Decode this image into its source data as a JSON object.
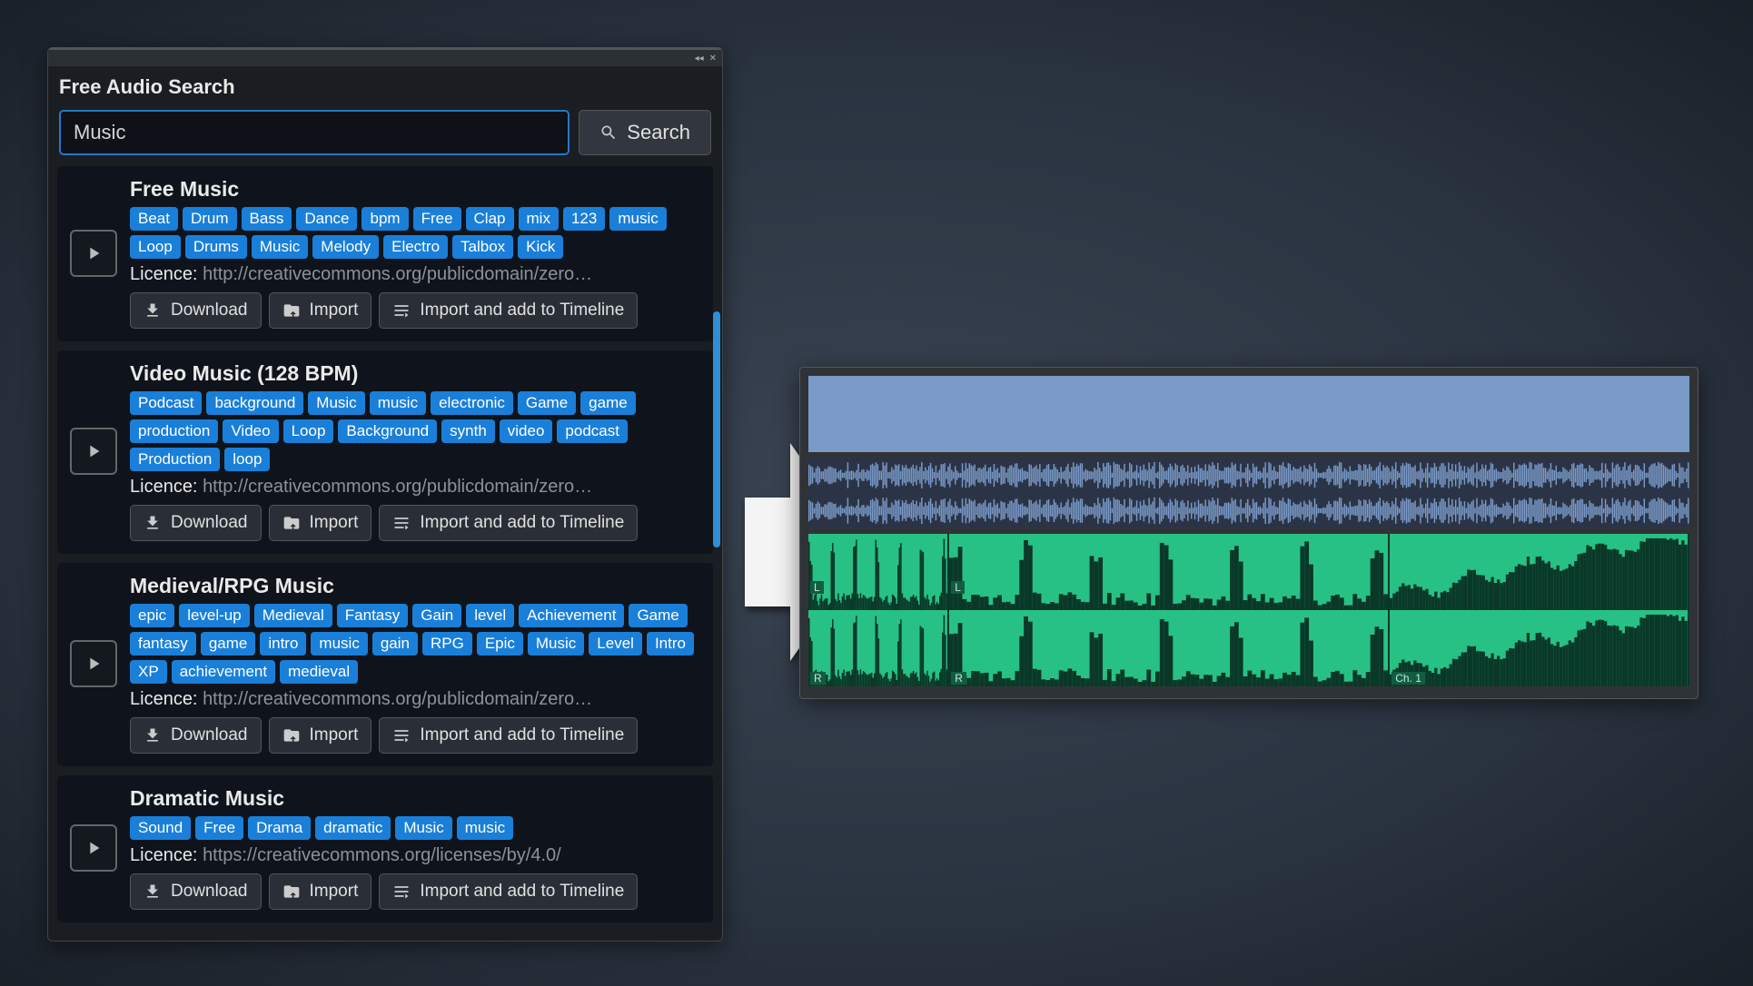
{
  "panel": {
    "title": "Free Audio Search",
    "search_input": "Music",
    "search_button": "Search",
    "licence_label": "Licence:",
    "actions": {
      "download": "Download",
      "import": "Import",
      "import_timeline": "Import and add to Timeline"
    }
  },
  "results": [
    {
      "title": "Free Music",
      "tags": [
        "Beat",
        "Drum",
        "Bass",
        "Dance",
        "bpm",
        "Free",
        "Clap",
        "mix",
        "123",
        "music",
        "Loop",
        "Drums",
        "Music",
        "Melody",
        "Electro",
        "Talbox",
        "Kick"
      ],
      "licence_url": "http://creativecommons.org/publicdomain/zero…",
      "has_timeline_btn": true
    },
    {
      "title": "Video Music (128 BPM)",
      "tags": [
        "Podcast",
        "background",
        "Music",
        "music",
        "electronic",
        "Game",
        "game",
        "production",
        "Video",
        "Loop",
        "Background",
        "synth",
        "video",
        "podcast",
        "Production",
        "loop"
      ],
      "licence_url": "http://creativecommons.org/publicdomain/zero…",
      "has_timeline_btn": true
    },
    {
      "title": "Medieval/RPG Music",
      "tags": [
        "epic",
        "level-up",
        "Medieval",
        "Fantasy",
        "Gain",
        "level",
        "Achievement",
        "Game",
        "fantasy",
        "game",
        "intro",
        "music",
        "gain",
        "RPG",
        "Epic",
        "Music",
        "Level",
        "Intro",
        "XP",
        "achievement",
        "medieval"
      ],
      "licence_url": "http://creativecommons.org/publicdomain/zero…",
      "has_timeline_btn": true
    },
    {
      "title": "Dramatic Music",
      "tags": [
        "Sound",
        "Free",
        "Drama",
        "dramatic",
        "Music",
        "music"
      ],
      "licence_url": "https://creativecommons.org/licenses/by/4.0/",
      "has_timeline_btn": true
    }
  ],
  "timeline": {
    "channel_left_label": "L",
    "channel_right_label": "R",
    "channel_1_label": "Ch. 1"
  }
}
